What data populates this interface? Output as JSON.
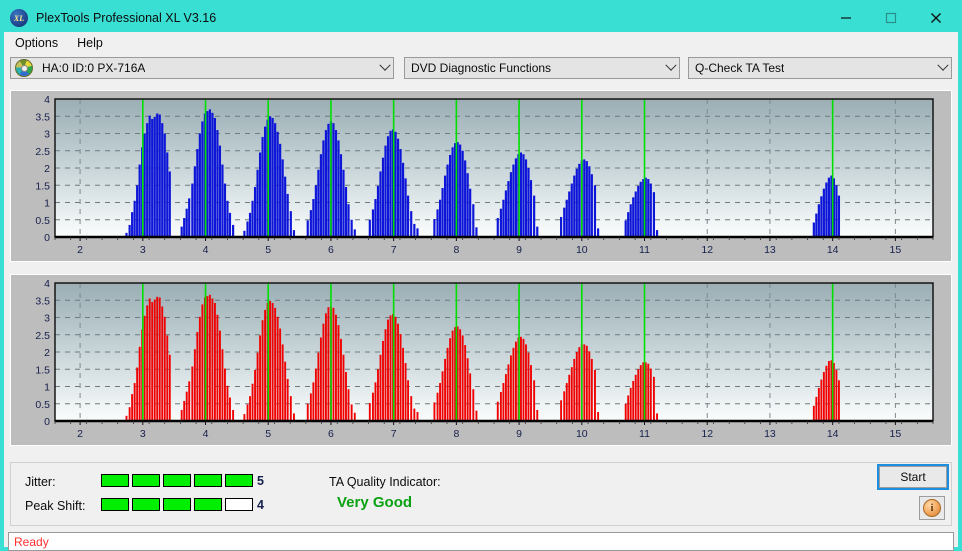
{
  "window": {
    "title": "PlexTools Professional XL V3.16",
    "app_icon": "xl-disc-icon",
    "minimize_label": "minimize-icon",
    "maximize_label": "maximize-icon",
    "close_label": "close-icon",
    "accent_color": "#3adfd4"
  },
  "menu": {
    "items": [
      {
        "label": "Options"
      },
      {
        "label": "Help"
      }
    ]
  },
  "toolbar": {
    "drive_select": {
      "value": "HA:0 ID:0  PX-716A",
      "icon": "disc-icon"
    },
    "function_select": {
      "value": "DVD Diagnostic Functions"
    },
    "test_select": {
      "value": "Q-Check TA Test"
    }
  },
  "results": {
    "jitter_label": "Jitter:",
    "jitter_value": "5",
    "jitter_filled": 5,
    "jitter_total": 5,
    "peak_shift_label": "Peak Shift:",
    "peak_shift_value": "4",
    "peak_shift_filled": 4,
    "peak_shift_total": 5,
    "ta_quality_label": "TA Quality Indicator:",
    "ta_quality_value": "Very Good",
    "ta_quality_color": "#0aa211",
    "start_label": "Start",
    "info_label": "i"
  },
  "statusbar": {
    "text": "Ready"
  },
  "chart_data": [
    {
      "id": "jitter-chart",
      "type": "bar",
      "title": "",
      "xlabel": "",
      "ylabel": "",
      "series_color": "#0d16d8",
      "marker_color": "#00e000",
      "background": "gradient-gray-blue",
      "grid": true,
      "xlim": [
        1.6,
        15.6
      ],
      "ylim": [
        0,
        4
      ],
      "yticks": [
        0,
        0.5,
        1,
        1.5,
        2,
        2.5,
        3,
        3.5,
        4
      ],
      "ytick_labels": [
        "0",
        "0.5",
        "1",
        "1.5",
        "2",
        "2.5",
        "3",
        "3.5",
        "4"
      ],
      "xticks": [
        2,
        3,
        4,
        5,
        6,
        7,
        8,
        9,
        10,
        11,
        12,
        13,
        14,
        15
      ],
      "xtick_labels": [
        "2",
        "3",
        "4",
        "5",
        "6",
        "7",
        "8",
        "9",
        "10",
        "11",
        "12",
        "13",
        "14",
        "15"
      ],
      "markers": [
        3,
        4,
        5,
        6,
        7,
        8,
        9,
        10,
        11,
        14
      ],
      "bar_width": 0.035,
      "x": [
        2.74,
        2.79,
        2.83,
        2.87,
        2.91,
        2.95,
        2.99,
        3.03,
        3.07,
        3.11,
        3.15,
        3.19,
        3.23,
        3.27,
        3.31,
        3.35,
        3.39,
        3.43,
        3.62,
        3.66,
        3.7,
        3.74,
        3.79,
        3.83,
        3.87,
        3.91,
        3.95,
        3.99,
        4.03,
        4.07,
        4.11,
        4.15,
        4.19,
        4.23,
        4.27,
        4.31,
        4.35,
        4.39,
        4.44,
        4.62,
        4.67,
        4.71,
        4.75,
        4.79,
        4.83,
        4.87,
        4.91,
        4.95,
        4.99,
        5.03,
        5.07,
        5.11,
        5.15,
        5.19,
        5.23,
        5.27,
        5.31,
        5.36,
        5.41,
        5.63,
        5.68,
        5.72,
        5.76,
        5.8,
        5.84,
        5.88,
        5.92,
        5.96,
        6.0,
        6.04,
        6.08,
        6.12,
        6.16,
        6.2,
        6.24,
        6.28,
        6.33,
        6.38,
        6.62,
        6.67,
        6.71,
        6.75,
        6.79,
        6.83,
        6.87,
        6.91,
        6.95,
        6.99,
        7.03,
        7.07,
        7.11,
        7.15,
        7.19,
        7.23,
        7.28,
        7.33,
        7.38,
        7.65,
        7.7,
        7.74,
        7.78,
        7.82,
        7.86,
        7.9,
        7.94,
        7.98,
        8.02,
        8.06,
        8.1,
        8.14,
        8.18,
        8.22,
        8.27,
        8.32,
        8.66,
        8.71,
        8.75,
        8.79,
        8.83,
        8.87,
        8.91,
        8.95,
        8.99,
        9.03,
        9.07,
        9.11,
        9.15,
        9.19,
        9.24,
        9.29,
        9.67,
        9.72,
        9.76,
        9.8,
        9.84,
        9.88,
        9.92,
        9.96,
        10.0,
        10.04,
        10.08,
        10.12,
        10.16,
        10.21,
        10.26,
        10.7,
        10.74,
        10.78,
        10.82,
        10.86,
        10.9,
        10.94,
        10.98,
        11.02,
        11.06,
        11.1,
        11.15,
        11.2,
        13.7,
        13.74,
        13.78,
        13.82,
        13.86,
        13.9,
        13.94,
        13.98,
        14.02,
        14.06,
        14.1,
        14.15
      ],
      "values": [
        0.12,
        0.35,
        0.72,
        1.05,
        1.5,
        2.1,
        2.6,
        3.0,
        3.3,
        3.52,
        3.42,
        3.48,
        3.58,
        3.55,
        3.3,
        3.0,
        2.45,
        1.9,
        0.3,
        0.55,
        0.82,
        1.12,
        1.55,
        2.05,
        2.55,
        3.0,
        3.35,
        3.58,
        3.65,
        3.7,
        3.6,
        3.45,
        3.1,
        2.65,
        2.1,
        1.55,
        1.05,
        0.7,
        0.35,
        0.18,
        0.45,
        0.7,
        1.05,
        1.45,
        1.95,
        2.45,
        2.9,
        3.2,
        3.4,
        3.5,
        3.45,
        3.3,
        3.05,
        2.7,
        2.25,
        1.75,
        1.25,
        0.75,
        0.2,
        0.48,
        0.78,
        1.1,
        1.5,
        1.95,
        2.4,
        2.8,
        3.1,
        3.28,
        3.35,
        3.3,
        3.1,
        2.8,
        2.4,
        1.95,
        1.45,
        0.95,
        0.5,
        0.22,
        0.5,
        0.8,
        1.1,
        1.48,
        1.9,
        2.3,
        2.65,
        2.92,
        3.08,
        3.12,
        3.05,
        2.85,
        2.55,
        2.15,
        1.7,
        1.2,
        0.75,
        0.38,
        0.25,
        0.52,
        0.8,
        1.08,
        1.42,
        1.78,
        2.1,
        2.38,
        2.6,
        2.72,
        2.75,
        2.68,
        2.5,
        2.22,
        1.85,
        1.4,
        0.95,
        0.28,
        0.55,
        0.82,
        1.08,
        1.35,
        1.62,
        1.88,
        2.1,
        2.28,
        2.4,
        2.45,
        2.4,
        2.25,
        2.0,
        1.65,
        1.2,
        0.3,
        0.58,
        0.85,
        1.08,
        1.32,
        1.55,
        1.78,
        1.98,
        2.12,
        2.22,
        2.25,
        2.2,
        2.05,
        1.82,
        1.5,
        0.25,
        0.48,
        0.72,
        0.95,
        1.15,
        1.32,
        1.48,
        1.6,
        1.68,
        1.72,
        1.68,
        1.55,
        1.3,
        0.2,
        0.42,
        0.68,
        0.95,
        1.18,
        1.4,
        1.58,
        1.72,
        1.78,
        1.7,
        1.5,
        1.2
      ]
    },
    {
      "id": "peak-shift-chart",
      "type": "bar",
      "title": "",
      "xlabel": "",
      "ylabel": "",
      "series_color": "#f00000",
      "marker_color": "#00e000",
      "background": "gradient-gray-blue",
      "grid": true,
      "xlim": [
        1.6,
        15.6
      ],
      "ylim": [
        0,
        4
      ],
      "yticks": [
        0,
        0.5,
        1,
        1.5,
        2,
        2.5,
        3,
        3.5,
        4
      ],
      "ytick_labels": [
        "0",
        "0.5",
        "1",
        "1.5",
        "2",
        "2.5",
        "3",
        "3.5",
        "4"
      ],
      "xticks": [
        2,
        3,
        4,
        5,
        6,
        7,
        8,
        9,
        10,
        11,
        12,
        13,
        14,
        15
      ],
      "xtick_labels": [
        "2",
        "3",
        "4",
        "5",
        "6",
        "7",
        "8",
        "9",
        "10",
        "11",
        "12",
        "13",
        "14",
        "15"
      ],
      "markers": [
        3,
        4,
        5,
        6,
        7,
        8,
        9,
        10,
        11,
        14
      ],
      "bar_width": 0.03,
      "x": [
        2.74,
        2.79,
        2.83,
        2.87,
        2.91,
        2.95,
        2.99,
        3.03,
        3.07,
        3.11,
        3.15,
        3.19,
        3.23,
        3.27,
        3.31,
        3.35,
        3.39,
        3.43,
        3.62,
        3.66,
        3.7,
        3.74,
        3.79,
        3.83,
        3.87,
        3.91,
        3.95,
        3.99,
        4.03,
        4.07,
        4.11,
        4.15,
        4.19,
        4.23,
        4.27,
        4.31,
        4.35,
        4.39,
        4.44,
        4.62,
        4.67,
        4.71,
        4.75,
        4.79,
        4.83,
        4.87,
        4.91,
        4.95,
        4.99,
        5.03,
        5.07,
        5.11,
        5.15,
        5.19,
        5.23,
        5.27,
        5.31,
        5.36,
        5.41,
        5.63,
        5.68,
        5.72,
        5.76,
        5.8,
        5.84,
        5.88,
        5.92,
        5.96,
        6.0,
        6.04,
        6.08,
        6.12,
        6.16,
        6.2,
        6.24,
        6.28,
        6.33,
        6.38,
        6.62,
        6.67,
        6.71,
        6.75,
        6.79,
        6.83,
        6.87,
        6.91,
        6.95,
        6.99,
        7.03,
        7.07,
        7.11,
        7.15,
        7.19,
        7.23,
        7.28,
        7.33,
        7.38,
        7.65,
        7.7,
        7.74,
        7.78,
        7.82,
        7.86,
        7.9,
        7.94,
        7.98,
        8.02,
        8.06,
        8.1,
        8.14,
        8.18,
        8.22,
        8.27,
        8.32,
        8.66,
        8.71,
        8.75,
        8.79,
        8.83,
        8.87,
        8.91,
        8.95,
        8.99,
        9.03,
        9.07,
        9.11,
        9.15,
        9.19,
        9.24,
        9.29,
        9.67,
        9.72,
        9.76,
        9.8,
        9.84,
        9.88,
        9.92,
        9.96,
        10.0,
        10.04,
        10.08,
        10.12,
        10.16,
        10.21,
        10.26,
        10.7,
        10.74,
        10.78,
        10.82,
        10.86,
        10.9,
        10.94,
        10.98,
        11.02,
        11.06,
        11.1,
        11.15,
        11.2,
        13.7,
        13.74,
        13.78,
        13.82,
        13.86,
        13.9,
        13.94,
        13.98,
        14.02,
        14.06,
        14.1,
        14.15
      ],
      "values": [
        0.15,
        0.4,
        0.78,
        1.1,
        1.55,
        2.15,
        2.65,
        3.05,
        3.35,
        3.55,
        3.45,
        3.52,
        3.6,
        3.58,
        3.32,
        3.02,
        2.48,
        1.92,
        0.32,
        0.58,
        0.85,
        1.15,
        1.58,
        2.08,
        2.58,
        3.02,
        3.38,
        3.58,
        3.62,
        3.66,
        3.55,
        3.42,
        3.08,
        2.62,
        2.08,
        1.52,
        1.02,
        0.68,
        0.32,
        0.2,
        0.48,
        0.72,
        1.08,
        1.48,
        1.98,
        2.48,
        2.92,
        3.22,
        3.42,
        3.48,
        3.42,
        3.28,
        3.02,
        2.68,
        2.22,
        1.72,
        1.22,
        0.72,
        0.22,
        0.5,
        0.8,
        1.12,
        1.52,
        1.98,
        2.42,
        2.82,
        3.12,
        3.3,
        3.32,
        3.28,
        3.08,
        2.78,
        2.38,
        1.92,
        1.42,
        0.92,
        0.48,
        0.24,
        0.52,
        0.82,
        1.12,
        1.5,
        1.92,
        2.32,
        2.66,
        2.94,
        3.06,
        3.1,
        3.02,
        2.82,
        2.52,
        2.12,
        1.68,
        1.18,
        0.72,
        0.36,
        0.26,
        0.54,
        0.82,
        1.1,
        1.44,
        1.8,
        2.12,
        2.4,
        2.62,
        2.72,
        2.74,
        2.66,
        2.48,
        2.2,
        1.82,
        1.38,
        0.92,
        0.3,
        0.56,
        0.84,
        1.1,
        1.36,
        1.64,
        1.9,
        2.12,
        2.3,
        2.42,
        2.44,
        2.38,
        2.22,
        1.98,
        1.62,
        1.18,
        0.32,
        0.6,
        0.86,
        1.1,
        1.34,
        1.56,
        1.8,
        2.0,
        2.14,
        2.24,
        2.22,
        2.18,
        2.02,
        1.8,
        1.48,
        0.26,
        0.5,
        0.74,
        0.96,
        1.16,
        1.34,
        1.5,
        1.62,
        1.7,
        1.7,
        1.66,
        1.52,
        1.28,
        0.22,
        0.44,
        0.7,
        0.96,
        1.2,
        1.42,
        1.6,
        1.74,
        1.76,
        1.68,
        1.48,
        1.18
      ]
    }
  ]
}
